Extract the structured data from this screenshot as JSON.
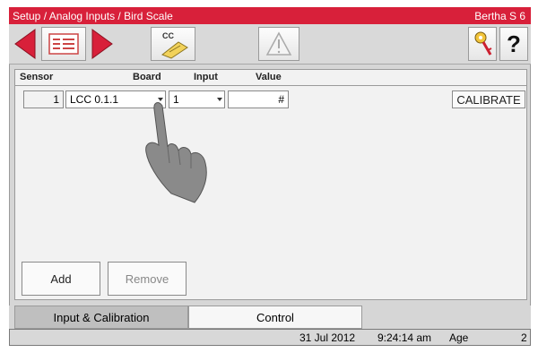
{
  "title_bar": {
    "path": "Setup / Analog Inputs / Bird Scale",
    "device": "Bertha S 6"
  },
  "toolbar": {
    "cc_label": "CC",
    "help_label": "?"
  },
  "table": {
    "headers": {
      "sensor": "Sensor",
      "board": "Board",
      "input": "Input",
      "value": "Value"
    },
    "row": {
      "sensor": "1",
      "board": "LCC 0.1.1",
      "input": "1",
      "value": "#"
    },
    "calibrate_label": "CALIBRATE"
  },
  "actions": {
    "add_label": "Add",
    "remove_label": "Remove"
  },
  "tabs": [
    {
      "label": "Input & Calibration"
    },
    {
      "label": "Control"
    }
  ],
  "status_bar": {
    "date": "31 Jul 2012",
    "time": "9:24:14 am",
    "age_label": "Age",
    "age_value": "2"
  },
  "colors": {
    "title_bar": "#d8203a",
    "nav_arrow": "#d8203a"
  },
  "icons": [
    "back-arrow-icon",
    "list-view-icon",
    "forward-arrow-icon",
    "cc-certificate-icon",
    "warning-icon",
    "key-icon",
    "help-icon",
    "pointing-hand-icon"
  ]
}
